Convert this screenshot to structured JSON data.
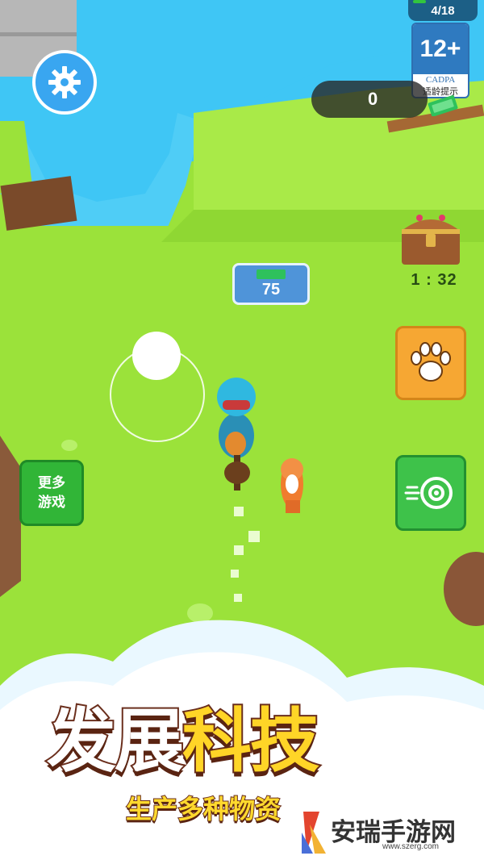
{
  "hud": {
    "progress_text": "4/18",
    "progress_fraction": 0.22,
    "money": "0",
    "timer": "1 : 32",
    "age_rating": {
      "badge": "12+",
      "org": "CADPA",
      "tip": "适龄提示"
    }
  },
  "world": {
    "cash_pad_value": "75"
  },
  "buttons": {
    "settings_icon": "gear-icon",
    "pet_icon": "paw-icon",
    "radar_icon": "eye-radar-icon",
    "more_games_line1": "更多",
    "more_games_line2": "游戏"
  },
  "banner": {
    "title_part1": "发展",
    "title_part2": "科技",
    "subtitle": "生产多种物资"
  },
  "watermark": {
    "name": "安瑞手游网",
    "url": "www.szerg.com"
  },
  "colors": {
    "grass": "#9be23a",
    "water": "#3fc6f5",
    "pet_button": "#f6a733",
    "radar_button": "#3ec24a",
    "settings_button": "#39a6f0"
  }
}
